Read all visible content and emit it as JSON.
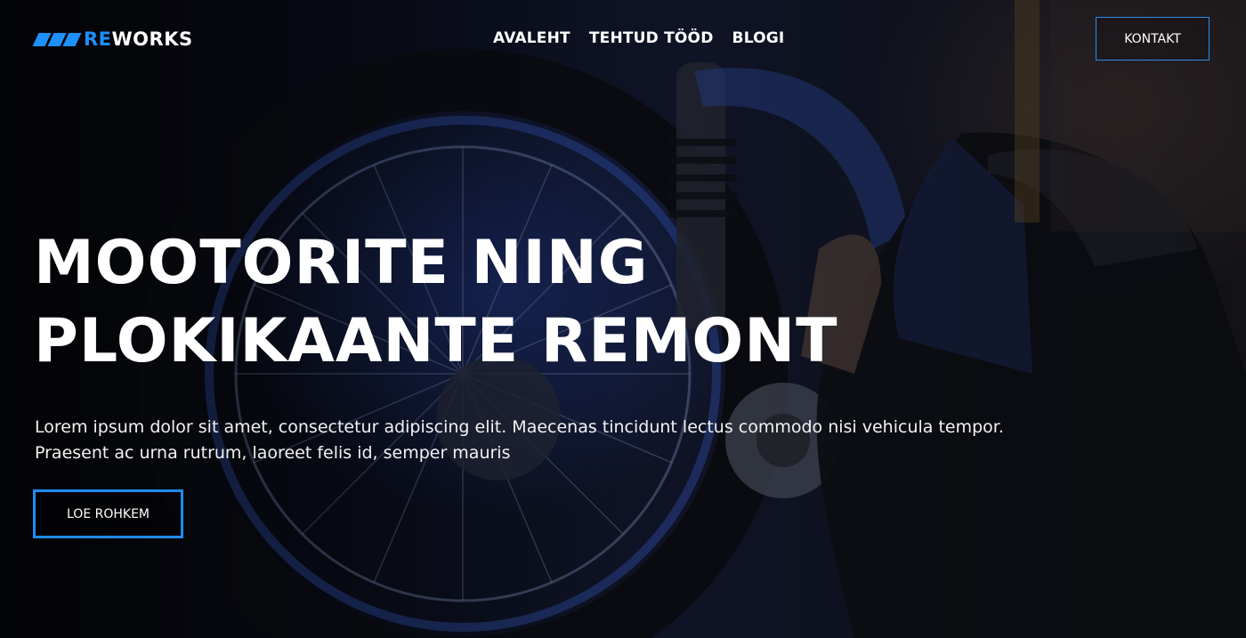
{
  "header": {
    "logo_accent": "RE",
    "logo_rest": "WORKS",
    "nav": [
      "AVALEHT",
      "TEHTUD TÖÖD",
      "BLOGI"
    ],
    "contact_label": "KONTAKT"
  },
  "hero": {
    "headline_line1": "MOOTORITE NING",
    "headline_line2": "PLOKIKAANTE REMONT",
    "lead": "Lorem ipsum dolor sit amet, consectetur adipiscing elit. Maecenas tincidunt lectus commodo nisi vehicula tempor. Praesent ac urna rutrum, laoreet felis id, semper mauris",
    "cta_label": "LOE ROHKEM",
    "background_image": "motorcycle-mechanic-welding-photo"
  },
  "colors": {
    "accent": "#1e90ff",
    "text": "#ffffff",
    "background": "#0a0d16"
  }
}
